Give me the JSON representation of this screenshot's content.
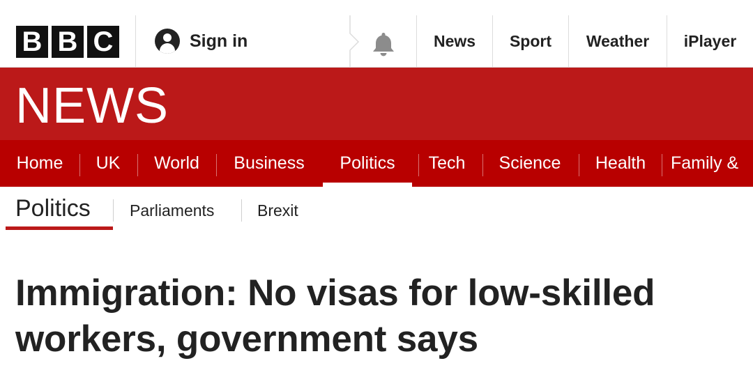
{
  "top_bar": {
    "logo_letters": [
      "B",
      "B",
      "C"
    ],
    "sign_in_label": "Sign in",
    "icons": {
      "account": "user-icon",
      "notifications": "bell-icon"
    },
    "links": [
      "News",
      "Sport",
      "Weather",
      "iPlayer"
    ]
  },
  "masthead": {
    "title": "NEWS"
  },
  "nav": {
    "items": [
      "Home",
      "UK",
      "World",
      "Business",
      "Politics",
      "Tech",
      "Science",
      "Health",
      "Family &"
    ],
    "active": "Politics"
  },
  "subnav": {
    "title": "Politics",
    "links": [
      "Parliaments",
      "Brexit"
    ]
  },
  "article": {
    "headline_line1": "Immigration: No visas for low-skilled",
    "headline_line2": "workers, government says"
  },
  "colors": {
    "bbc_red": "#bb1919",
    "nav_red": "#b80000",
    "text_dark": "#222222"
  }
}
